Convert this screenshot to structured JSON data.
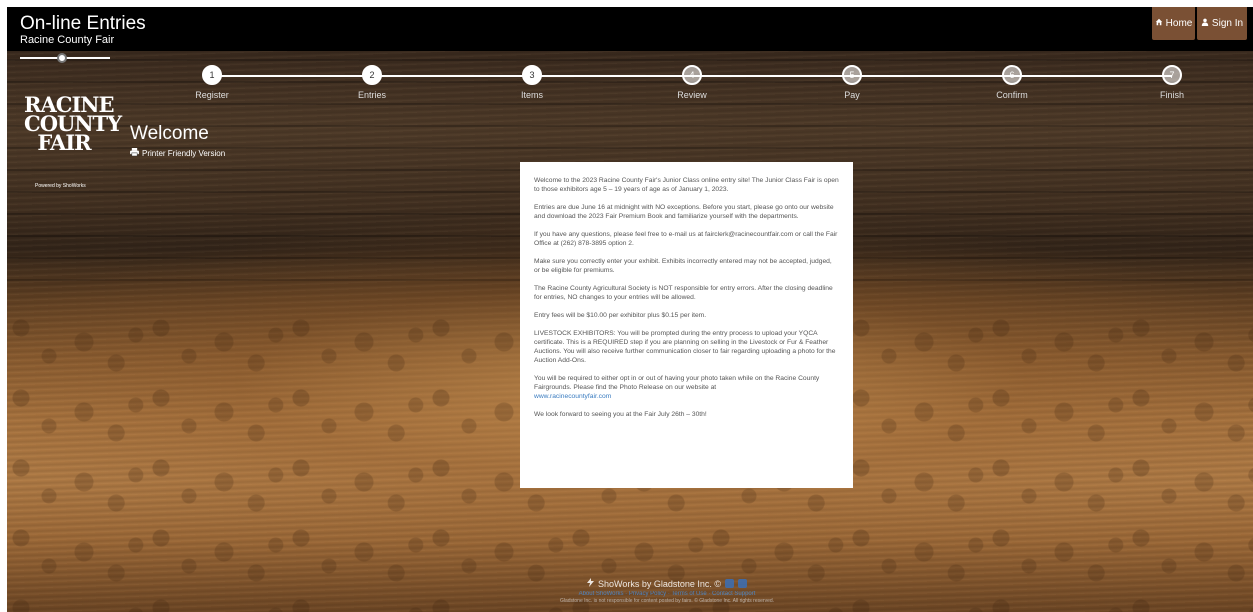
{
  "header": {
    "title": "On-line Entries",
    "subtitle": "Racine County Fair",
    "home_label": "Home",
    "signin_label": "Sign In",
    "home_icon": "home-icon",
    "signin_icon": "user-icon"
  },
  "steps": [
    {
      "number": "1",
      "label": "Register",
      "active": true
    },
    {
      "number": "2",
      "label": "Entries",
      "active": true
    },
    {
      "number": "3",
      "label": "Items",
      "active": true
    },
    {
      "number": "4",
      "label": "Review",
      "active": false
    },
    {
      "number": "5",
      "label": "Pay",
      "active": false
    },
    {
      "number": "6",
      "label": "Confirm",
      "active": false
    },
    {
      "number": "7",
      "label": "Finish",
      "active": false
    }
  ],
  "sidebar": {
    "logo_line1": "RACINE",
    "logo_line2": "COUNTY",
    "logo_line3": "FAIR",
    "powered_by": "Powered by ShoWorks"
  },
  "main": {
    "title": "Welcome",
    "printer_link": "Printer Friendly Version",
    "printer_icon": "printer-icon"
  },
  "content": {
    "p1": "Welcome to the 2023 Racine County Fair's Junior Class online entry site!  The Junior Class Fair is open to those exhibitors age 5 – 19 years of age as of January 1, 2023.",
    "p2": "Entries are due June 16 at midnight with NO exceptions.  Before you start, please go onto our website and download the 2023 Fair Premium Book and familiarize yourself with the departments.",
    "p3": "If you have any questions, please feel free to e-mail us at fairclerk@racinecountfair.com or call the Fair Office at (262) 878-3895 option 2.",
    "p4": "Make sure you correctly enter your exhibit.  Exhibits incorrectly entered may not be accepted, judged, or be eligible for premiums.",
    "p5": "The Racine County Agricultural Society is NOT responsible for entry errors.  After the closing deadline for entries, NO changes to your entries will be allowed.",
    "p6": "Entry fees will be $10.00 per exhibitor plus $0.15 per item.",
    "p7": "LIVESTOCK EXHIBITORS: You will be prompted during the entry process to upload your YQCA certificate. This is a REQUIRED step if you are planning on selling in the Livestock or Fur & Feather Auctions. You will also receive further communication closer to fair regarding uploading a photo for the Auction Add-Ons.",
    "p8": "You will be required to either opt in or out of having your photo taken while on the Racine County Fairgrounds. Please find the Photo Release on our website at",
    "p8_link": "www.racinecountyfair.com",
    "p9": "We look forward to seeing you at the Fair July 26th – 30th!"
  },
  "footer": {
    "brand": "ShoWorks by Gladstone Inc. ©",
    "links": "About ShoWorks  ·  Privacy Policy  ·  Terms of Use  ·  Contact Support",
    "disclaimer": "Gladstone Inc. is not responsible for content posted by fairs. © Gladstone Inc. All rights reserved."
  }
}
